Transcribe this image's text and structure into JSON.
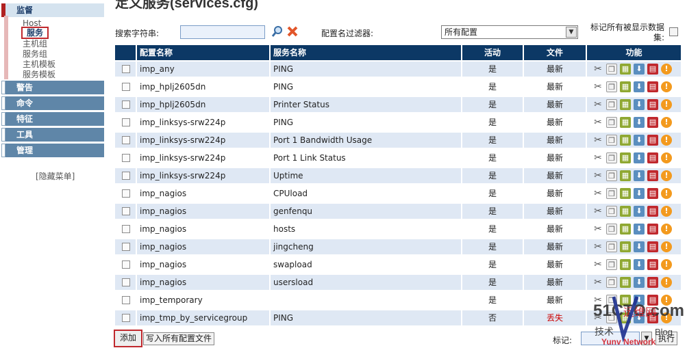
{
  "sidebar": {
    "sections": [
      {
        "label": "监督",
        "active": true
      },
      {
        "label": "警告"
      },
      {
        "label": "命令"
      },
      {
        "label": "特征"
      },
      {
        "label": "工具"
      },
      {
        "label": "管理"
      }
    ],
    "monitor_items": [
      "Host",
      "服务",
      "主机组",
      "服务组",
      "主机模板",
      "服务模板"
    ],
    "selected_item": "服务",
    "hide_menu": "[隐藏菜单]"
  },
  "page_title": "定义服务(services.cfg)",
  "toolbar": {
    "search_label": "搜索字符串:",
    "search_value": "",
    "filter_label": "配置名过滤器:",
    "filter_selected": "所有配置",
    "mark_all_label": "标记所有被显示数据集:"
  },
  "table": {
    "headers": {
      "config_name": "配置名称",
      "service_name": "服务名称",
      "active": "活动",
      "file": "文件",
      "function": "功能"
    },
    "rows": [
      {
        "config": "imp_any",
        "service": "PING",
        "active": "是",
        "file": "最新"
      },
      {
        "config": "imp_hplj2605dn",
        "service": "PING",
        "active": "是",
        "file": "最新"
      },
      {
        "config": "imp_hplj2605dn",
        "service": "Printer Status",
        "active": "是",
        "file": "最新"
      },
      {
        "config": "imp_linksys-srw224p",
        "service": "PING",
        "active": "是",
        "file": "最新"
      },
      {
        "config": "imp_linksys-srw224p",
        "service": "Port 1 Bandwidth Usage",
        "active": "是",
        "file": "最新"
      },
      {
        "config": "imp_linksys-srw224p",
        "service": "Port 1 Link Status",
        "active": "是",
        "file": "最新"
      },
      {
        "config": "imp_linksys-srw224p",
        "service": "Uptime",
        "active": "是",
        "file": "最新"
      },
      {
        "config": "imp_nagios",
        "service": "CPUload",
        "active": "是",
        "file": "最新"
      },
      {
        "config": "imp_nagios",
        "service": "genfenqu",
        "active": "是",
        "file": "最新"
      },
      {
        "config": "imp_nagios",
        "service": "hosts",
        "active": "是",
        "file": "最新"
      },
      {
        "config": "imp_nagios",
        "service": "jingcheng",
        "active": "是",
        "file": "最新"
      },
      {
        "config": "imp_nagios",
        "service": "swapload",
        "active": "是",
        "file": "最新"
      },
      {
        "config": "imp_nagios",
        "service": "usersload",
        "active": "是",
        "file": "最新"
      },
      {
        "config": "imp_temporary",
        "service": "",
        "active": "是",
        "file": "最新"
      },
      {
        "config": "imp_tmp_by_servicegroup",
        "service": "PING",
        "active": "否",
        "file": "丢失"
      }
    ],
    "icons": [
      "edit-icon",
      "copy-icon",
      "delete-icon",
      "download-icon",
      "info-icon",
      "warning-icon"
    ]
  },
  "footer": {
    "add_label": "添加",
    "write_all_label": "写入所有配置文件",
    "tag_label": "标记:",
    "exec_label": "执行"
  },
  "watermark": {
    "site": "51CTO.com",
    "line1": "运维网",
    "line2": "技术",
    "line3": "Blog",
    "line4": "Yunv Network"
  },
  "colors": {
    "header_bg": "#0c3865",
    "row_alt": "#dfe8f4",
    "menu_bg": "#5f86a8",
    "highlight": "#c0282d",
    "missing": "#cc0000"
  }
}
